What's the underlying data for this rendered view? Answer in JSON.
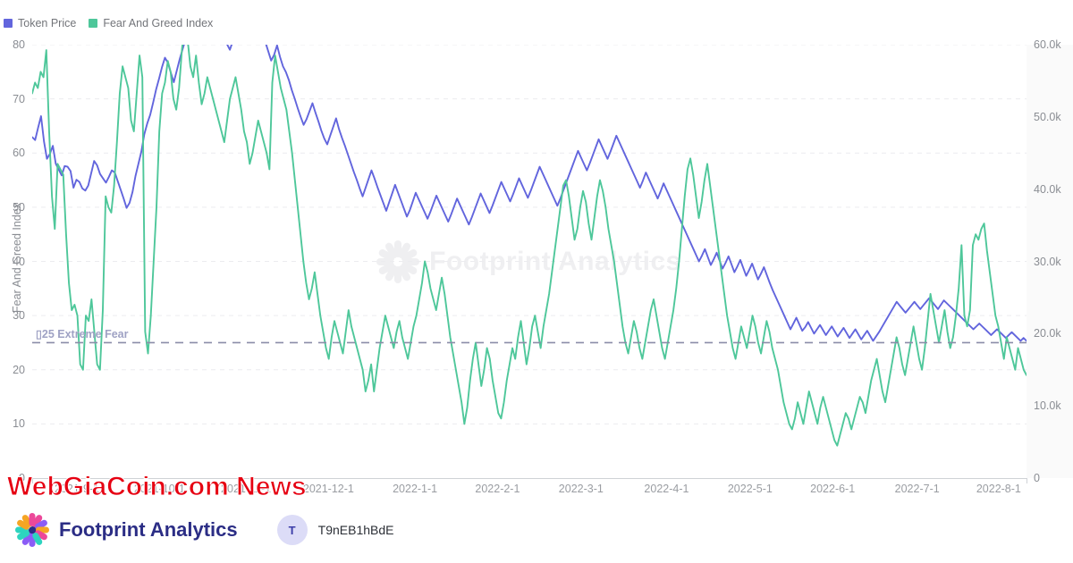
{
  "legend": {
    "items": [
      {
        "label": "Token Price",
        "color": "#6265dd",
        "icon": "square-swatch"
      },
      {
        "label": "Fear And Greed Index",
        "color": "#4ec79a",
        "icon": "square-swatch"
      }
    ]
  },
  "watermark": {
    "text": "Footprint Analytics",
    "icon": "pinwheel-icon"
  },
  "overlay": {
    "news_banner": "WebGiaCoin.com News"
  },
  "footer": {
    "brand_name": "Footprint Analytics",
    "brand_icon": "pinwheel-logo-icon",
    "user": {
      "avatar_initial": "T",
      "name": "T9nEB1hBdE"
    }
  },
  "chart_data": {
    "type": "line",
    "title": "",
    "xlabel": "",
    "ylabel": "Fear And Greed Index",
    "y2label": "",
    "grid": true,
    "legend_position": "top-left",
    "ylim": [
      0,
      80
    ],
    "y2lim": [
      0,
      60000
    ],
    "yticks": [
      0,
      10,
      20,
      30,
      40,
      50,
      60,
      70,
      80
    ],
    "ytick_labels": [
      "0",
      "10",
      "20",
      "30",
      "40",
      "50",
      "60",
      "70",
      "80"
    ],
    "y2ticks": [
      0,
      10000,
      20000,
      30000,
      40000,
      50000,
      60000
    ],
    "y2tick_labels": [
      "0",
      "10.0k",
      "20.0k",
      "30.0k",
      "40.0k",
      "50.0k",
      "60.0k"
    ],
    "xtick_labels": [
      "2021-9-1",
      "2021-10-1",
      "2021-11-1",
      "2021-12-1",
      "2022-1-1",
      "2022-2-1",
      "2022-3-1",
      "2022-4-1",
      "2022-5-1",
      "2022-6-1",
      "2022-7-1",
      "2022-8-1"
    ],
    "xtick_positions": [
      0.045,
      0.128,
      0.215,
      0.298,
      0.385,
      0.468,
      0.552,
      0.638,
      0.722,
      0.805,
      0.89,
      0.972
    ],
    "annotations": [
      {
        "text": "25 Extreme Fear",
        "value": 25,
        "axis": "left",
        "style": "dashed-line",
        "color": "#8a8ca8",
        "prefix_glyph": " "
      }
    ],
    "series": [
      {
        "name": "Token Price",
        "color": "#6265dd",
        "axis": "right",
        "unit": "USD",
        "values": [
          47200,
          46800,
          48500,
          50100,
          46600,
          44200,
          44900,
          46000,
          43500,
          42700,
          41900,
          43200,
          43100,
          42500,
          40200,
          41300,
          41000,
          40100,
          39800,
          40500,
          42200,
          43900,
          43300,
          42100,
          41500,
          40900,
          41700,
          42600,
          42300,
          41100,
          39900,
          38700,
          37400,
          38100,
          39600,
          41800,
          43500,
          45200,
          47600,
          49100,
          50300,
          52000,
          53800,
          55300,
          56900,
          58200,
          57500,
          56100,
          54800,
          56400,
          58000,
          59400,
          60800,
          62100,
          63900,
          65700,
          64200,
          63100,
          62500,
          64000,
          63200,
          61800,
          62700,
          63500,
          62800,
          61200,
          60100,
          59300,
          60500,
          62000,
          63600,
          65100,
          66800,
          68200,
          67100,
          65800,
          64300,
          63000,
          61700,
          60400,
          59100,
          57800,
          58600,
          59900,
          58300,
          57000,
          56200,
          55100,
          53700,
          52500,
          51200,
          50000,
          48900,
          49700,
          50800,
          51900,
          50600,
          49400,
          48100,
          47000,
          46200,
          47400,
          48600,
          49800,
          48300,
          47100,
          46000,
          44800,
          43600,
          42400,
          41300,
          40100,
          39000,
          40200,
          41400,
          42600,
          41500,
          40300,
          39200,
          38100,
          37000,
          38200,
          39400,
          40600,
          39500,
          38400,
          37300,
          36200,
          37100,
          38300,
          39500,
          38600,
          37700,
          36800,
          35900,
          36900,
          38000,
          39100,
          38200,
          37300,
          36400,
          35500,
          36500,
          37600,
          38700,
          37800,
          36900,
          36000,
          35100,
          36100,
          37200,
          38300,
          39400,
          38500,
          37600,
          36700,
          37700,
          38800,
          39900,
          41000,
          40100,
          39200,
          38300,
          39300,
          40400,
          41500,
          40600,
          39700,
          38800,
          39800,
          40900,
          42000,
          43100,
          42200,
          41300,
          40400,
          39500,
          38600,
          37700,
          38700,
          39800,
          40900,
          42000,
          43100,
          44200,
          45300,
          44400,
          43500,
          42600,
          43600,
          44700,
          45800,
          46900,
          46000,
          45100,
          44200,
          45200,
          46300,
          47400,
          46500,
          45600,
          44700,
          43800,
          42900,
          42000,
          41100,
          40200,
          41200,
          42300,
          41400,
          40500,
          39600,
          38700,
          39700,
          40800,
          39900,
          39000,
          38100,
          37200,
          36300,
          35400,
          34500,
          33600,
          32700,
          31800,
          30900,
          30000,
          30800,
          31700,
          30600,
          29500,
          30300,
          31200,
          30100,
          29000,
          29800,
          30700,
          29600,
          28500,
          29300,
          30200,
          29100,
          28000,
          28800,
          29700,
          28600,
          27500,
          28300,
          29200,
          28100,
          27000,
          26000,
          25100,
          24200,
          23300,
          22400,
          21500,
          20600,
          21400,
          22200,
          21300,
          20400,
          20900,
          21600,
          20800,
          20000,
          20600,
          21200,
          20500,
          19800,
          20400,
          21000,
          20300,
          19600,
          20200,
          20800,
          20100,
          19400,
          20000,
          20600,
          19900,
          19200,
          19800,
          20400,
          19700,
          19000,
          19600,
          20200,
          20900,
          21600,
          22300,
          23000,
          23700,
          24400,
          23900,
          23400,
          22900,
          23400,
          23900,
          24400,
          23900,
          23400,
          23900,
          24400,
          24900,
          24400,
          23900,
          23400,
          24000,
          24600,
          24200,
          23800,
          23400,
          23000,
          22600,
          22200,
          21800,
          21400,
          21000,
          20600,
          21000,
          21400,
          21000,
          20600,
          20200,
          19800,
          20200,
          20600,
          20200,
          19800,
          19400,
          19800,
          20200,
          19800,
          19400,
          19000,
          19400,
          19000
        ]
      },
      {
        "name": "Fear And Greed Index",
        "color": "#4ec79a",
        "axis": "left",
        "unit": "index",
        "values": [
          71,
          73,
          72,
          75,
          74,
          79,
          64,
          52,
          46,
          58,
          57,
          56,
          45,
          36,
          31,
          32,
          30,
          21,
          20,
          30,
          29,
          33,
          27,
          21,
          20,
          31,
          52,
          50,
          49,
          54,
          62,
          71,
          76,
          74,
          72,
          66,
          64,
          71,
          78,
          74,
          27,
          23,
          30,
          40,
          50,
          64,
          71,
          73,
          77,
          75,
          70,
          68,
          72,
          79,
          84,
          81,
          76,
          74,
          78,
          73,
          69,
          71,
          74,
          72,
          70,
          68,
          66,
          64,
          62,
          66,
          70,
          72,
          74,
          71,
          68,
          64,
          62,
          58,
          60,
          63,
          66,
          64,
          62,
          60,
          57,
          73,
          78,
          75,
          72,
          70,
          68,
          64,
          60,
          55,
          50,
          45,
          40,
          36,
          33,
          35,
          38,
          34,
          30,
          27,
          24,
          22,
          26,
          29,
          27,
          25,
          23,
          27,
          31,
          28,
          26,
          24,
          22,
          20,
          16,
          18,
          21,
          16,
          20,
          24,
          27,
          30,
          28,
          26,
          24,
          27,
          29,
          26,
          24,
          22,
          25,
          28,
          30,
          33,
          36,
          40,
          38,
          35,
          33,
          31,
          34,
          37,
          34,
          30,
          26,
          23,
          20,
          17,
          14,
          10,
          13,
          18,
          22,
          25,
          21,
          17,
          20,
          24,
          22,
          18,
          15,
          12,
          11,
          14,
          18,
          21,
          24,
          22,
          26,
          29,
          25,
          21,
          24,
          28,
          30,
          27,
          24,
          28,
          31,
          34,
          38,
          42,
          46,
          50,
          54,
          55,
          52,
          48,
          44,
          46,
          50,
          53,
          51,
          47,
          44,
          48,
          52,
          55,
          53,
          50,
          46,
          43,
          40,
          36,
          32,
          28,
          25,
          23,
          26,
          29,
          27,
          24,
          22,
          25,
          28,
          31,
          33,
          30,
          27,
          24,
          22,
          25,
          28,
          31,
          35,
          40,
          46,
          52,
          57,
          59,
          56,
          52,
          48,
          51,
          55,
          58,
          54,
          50,
          46,
          42,
          38,
          34,
          30,
          27,
          24,
          22,
          25,
          28,
          26,
          24,
          27,
          30,
          28,
          25,
          23,
          26,
          29,
          27,
          24,
          22,
          20,
          17,
          14,
          12,
          10,
          9,
          11,
          14,
          12,
          10,
          13,
          16,
          14,
          12,
          10,
          13,
          15,
          13,
          11,
          9,
          7,
          6,
          8,
          10,
          12,
          11,
          9,
          11,
          13,
          15,
          14,
          12,
          15,
          18,
          20,
          22,
          19,
          16,
          14,
          17,
          20,
          23,
          26,
          24,
          21,
          19,
          22,
          25,
          28,
          25,
          22,
          20,
          24,
          29,
          34,
          31,
          28,
          25,
          28,
          31,
          27,
          24,
          26,
          30,
          35,
          43,
          30,
          28,
          31,
          43,
          45,
          44,
          46,
          47,
          42,
          38,
          34,
          30,
          28,
          25,
          22,
          26,
          24,
          22,
          20,
          24,
          22,
          20,
          19
        ]
      }
    ]
  }
}
